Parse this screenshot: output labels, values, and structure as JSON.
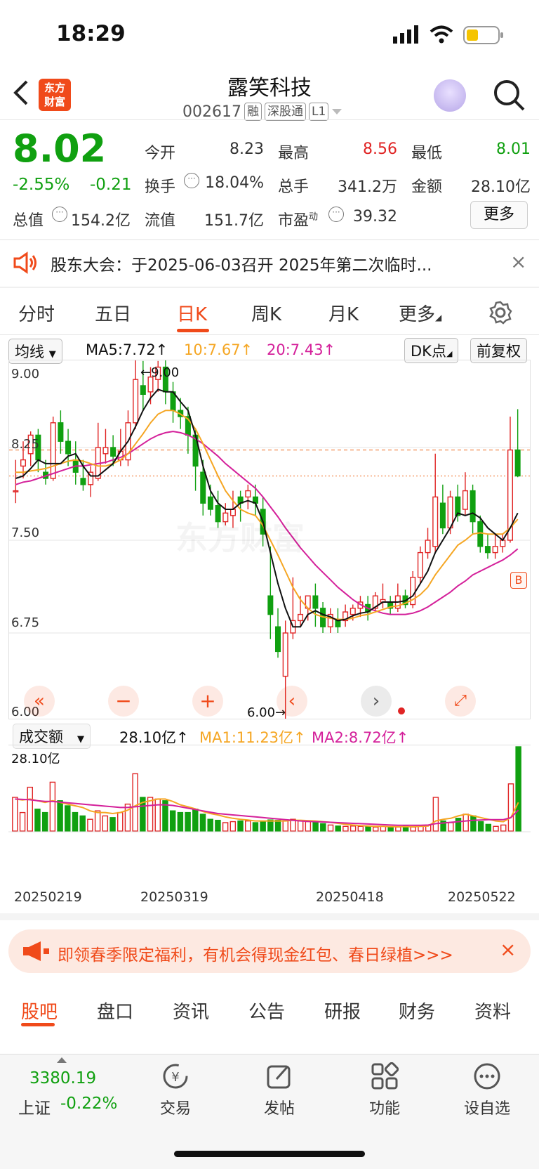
{
  "status": {
    "time": "18:29"
  },
  "header": {
    "logo": "东方财富",
    "name": "露笑科技",
    "code": "002617",
    "tags": [
      "融",
      "深股通",
      "L1"
    ],
    "back_icon": "chevron-left-icon",
    "search_icon": "search-icon"
  },
  "quote": {
    "price": "8.02",
    "pct": "-2.55%",
    "change": "-0.21",
    "rows": [
      [
        {
          "l": "今开",
          "v": "8.23",
          "c": "#333333"
        },
        {
          "l": "最高",
          "v": "8.56",
          "c": "#e02424"
        },
        {
          "l": "最低",
          "v": "8.01",
          "c": "#10a010"
        }
      ],
      [
        {
          "l": "换手",
          "v": "18.04%",
          "c": "#333333"
        },
        {
          "l": "总手",
          "v": "341.2万",
          "c": "#333333"
        },
        {
          "l": "金额",
          "v": "28.10亿",
          "c": "#333333"
        }
      ],
      [
        {
          "l": "总值",
          "v": "154.2亿",
          "c": "#333333"
        },
        {
          "l": "流值",
          "v": "151.7亿",
          "c": "#333333"
        },
        {
          "l": "市盈",
          "v": "39.32",
          "c": "#333333",
          "sup": "动"
        }
      ]
    ],
    "more": "更多"
  },
  "notice": {
    "text": "股东大会：于2025-06-03召开 2025年第二次临时...",
    "close": "×"
  },
  "ktabs": [
    "分时",
    "五日",
    "日K",
    "周K",
    "月K",
    "更多"
  ],
  "ma": {
    "select": "均线",
    "ma5": "MA5:7.72↑",
    "ma10": "10:7.67↑",
    "ma20": "20:7.43↑",
    "dk": "DK点",
    "fq": "前复权"
  },
  "kchart": {
    "yticks": [
      "9.00",
      "8.25",
      "7.50",
      "6.75",
      "6.00"
    ],
    "max_label": "←9.00",
    "min_label": "6.00→",
    "buy_marker": "B",
    "watermark": "东方财富"
  },
  "vol": {
    "select": "成交额",
    "value": "28.10亿↑",
    "ma1": "MA1:11.23亿↑",
    "ma2": "MA2:8.72亿↑",
    "top": "28.10亿",
    "dates": [
      "20250219",
      "20250319",
      "20250418",
      "20250522"
    ]
  },
  "promo": {
    "text": "即领春季限定福利，有机会得现金红包、春日绿植>>>",
    "close": "×"
  },
  "btabs": [
    "股吧",
    "盘口",
    "资讯",
    "公告",
    "研报",
    "财务",
    "资料"
  ],
  "nav": {
    "index_value": "3380.19",
    "index_name": "上证",
    "index_pct": "-0.22%",
    "items": [
      "交易",
      "发帖",
      "功能",
      "设自选"
    ]
  },
  "chart_data": {
    "type": "candlestick",
    "ylim": [
      6.0,
      9.0
    ],
    "ohlc": [
      [
        7.9,
        8.15,
        7.9,
        7.8
      ],
      [
        8.1,
        8.3,
        8.15,
        8.0
      ],
      [
        8.2,
        8.38,
        8.35,
        8.1
      ],
      [
        8.35,
        8.4,
        8.15,
        8.05
      ],
      [
        8.05,
        8.15,
        8.0,
        7.95
      ],
      [
        8.0,
        8.5,
        8.45,
        7.98
      ],
      [
        8.45,
        8.55,
        8.3,
        8.2
      ],
      [
        8.3,
        8.4,
        8.2,
        8.1
      ],
      [
        8.15,
        8.3,
        8.05,
        7.95
      ],
      [
        8.0,
        8.15,
        7.95,
        7.9
      ],
      [
        7.95,
        8.1,
        8.05,
        7.85
      ],
      [
        8.0,
        8.45,
        8.25,
        7.98
      ],
      [
        8.2,
        8.4,
        8.25,
        8.12
      ],
      [
        8.25,
        8.35,
        8.18,
        8.1
      ],
      [
        8.15,
        8.4,
        8.22,
        8.1
      ],
      [
        8.15,
        8.55,
        8.45,
        8.1
      ],
      [
        8.45,
        9.0,
        8.8,
        8.4
      ],
      [
        8.75,
        8.95,
        8.68,
        8.55
      ],
      [
        8.7,
        8.9,
        8.82,
        8.6
      ],
      [
        8.8,
        8.95,
        8.9,
        8.7
      ],
      [
        8.9,
        9.0,
        8.7,
        8.6
      ],
      [
        8.7,
        8.78,
        8.55,
        8.45
      ],
      [
        8.55,
        8.65,
        8.5,
        8.4
      ],
      [
        8.5,
        8.58,
        8.35,
        8.2
      ],
      [
        8.35,
        8.4,
        8.1,
        7.9
      ],
      [
        8.05,
        8.15,
        7.8,
        7.7
      ],
      [
        7.85,
        7.95,
        7.75,
        7.7
      ],
      [
        7.78,
        7.9,
        7.65,
        7.6
      ],
      [
        7.65,
        7.8,
        7.72,
        7.62
      ],
      [
        7.7,
        7.9,
        7.75,
        7.6
      ],
      [
        7.85,
        7.9,
        7.8,
        7.65
      ],
      [
        7.85,
        7.95,
        7.9,
        7.75
      ],
      [
        7.85,
        7.95,
        7.8,
        7.7
      ],
      [
        7.75,
        7.85,
        7.55,
        7.45
      ],
      [
        7.05,
        7.45,
        6.9,
        6.7
      ],
      [
        6.8,
        6.95,
        6.6,
        6.55
      ],
      [
        6.4,
        6.85,
        6.75,
        6.0
      ],
      [
        6.75,
        7.2,
        6.85,
        6.7
      ],
      [
        6.85,
        7.05,
        6.9,
        6.8
      ],
      [
        6.95,
        7.05,
        7.05,
        6.85
      ],
      [
        7.05,
        7.15,
        6.95,
        6.8
      ],
      [
        6.95,
        7.0,
        6.8,
        6.75
      ],
      [
        6.8,
        6.95,
        6.9,
        6.75
      ],
      [
        6.85,
        6.95,
        6.8,
        6.75
      ],
      [
        6.85,
        6.98,
        6.92,
        6.8
      ],
      [
        6.9,
        6.98,
        6.95,
        6.85
      ],
      [
        6.95,
        7.05,
        7.0,
        6.88
      ],
      [
        6.98,
        7.05,
        6.92,
        6.85
      ],
      [
        6.95,
        7.08,
        7.05,
        6.92
      ],
      [
        7.0,
        7.15,
        7.02,
        6.95
      ],
      [
        7.0,
        7.05,
        6.95,
        6.9
      ],
      [
        6.95,
        7.15,
        7.05,
        6.92
      ],
      [
        7.05,
        7.1,
        6.98,
        6.95
      ],
      [
        6.98,
        7.25,
        7.2,
        6.95
      ],
      [
        7.2,
        7.45,
        7.4,
        7.15
      ],
      [
        7.4,
        7.6,
        7.5,
        7.35
      ],
      [
        7.45,
        8.2,
        7.85,
        7.4
      ],
      [
        7.8,
        7.95,
        7.6,
        7.55
      ],
      [
        7.6,
        7.9,
        7.85,
        7.55
      ],
      [
        7.85,
        7.95,
        7.7,
        7.65
      ],
      [
        7.75,
        8.05,
        7.9,
        7.7
      ],
      [
        7.9,
        7.95,
        7.65,
        7.55
      ],
      [
        7.65,
        7.7,
        7.45,
        7.4
      ],
      [
        7.45,
        7.55,
        7.4,
        7.35
      ],
      [
        7.4,
        7.55,
        7.45,
        7.35
      ],
      [
        7.45,
        7.55,
        7.5,
        7.4
      ],
      [
        7.5,
        8.5,
        8.23,
        7.48
      ],
      [
        8.23,
        8.56,
        8.02,
        8.01
      ]
    ],
    "ma5": [
      8.0,
      8.02,
      8.08,
      8.15,
      8.12,
      8.12,
      8.12,
      8.18,
      8.2,
      8.1,
      8.02,
      8.02,
      8.07,
      8.12,
      8.22,
      8.3,
      8.42,
      8.55,
      8.65,
      8.72,
      8.7,
      8.7,
      8.62,
      8.55,
      8.35,
      8.1,
      7.9,
      7.8,
      7.75,
      7.75,
      7.8,
      7.82,
      7.8,
      7.65,
      7.4,
      7.15,
      6.95,
      6.8,
      6.8,
      6.9,
      6.93,
      6.9,
      6.88,
      6.85,
      6.86,
      6.89,
      6.91,
      6.92,
      6.96,
      7.0,
      7.0,
      7.0,
      7.01,
      7.05,
      7.15,
      7.25,
      7.4,
      7.5,
      7.6,
      7.72,
      7.7,
      7.72,
      7.68,
      7.6,
      7.55,
      7.5,
      7.6,
      7.72
    ],
    "ma10": [
      8.05,
      8.05,
      8.06,
      8.07,
      8.08,
      8.1,
      8.12,
      8.14,
      8.15,
      8.14,
      8.12,
      8.1,
      8.1,
      8.12,
      8.15,
      8.2,
      8.28,
      8.36,
      8.45,
      8.52,
      8.55,
      8.55,
      8.52,
      8.48,
      8.4,
      8.28,
      8.15,
      8.02,
      7.9,
      7.82,
      7.75,
      7.72,
      7.7,
      7.62,
      7.5,
      7.38,
      7.25,
      7.12,
      7.02,
      6.95,
      6.9,
      6.88,
      6.87,
      6.86,
      6.86,
      6.87,
      6.89,
      6.9,
      6.92,
      6.94,
      6.96,
      6.97,
      6.99,
      7.02,
      7.06,
      7.12,
      7.22,
      7.3,
      7.38,
      7.46,
      7.5,
      7.55,
      7.56,
      7.55,
      7.55,
      7.55,
      7.6,
      7.67
    ],
    "ma20": [
      7.95,
      7.97,
      7.98,
      8.0,
      8.02,
      8.04,
      8.06,
      8.08,
      8.1,
      8.1,
      8.11,
      8.12,
      8.13,
      8.15,
      8.17,
      8.2,
      8.24,
      8.28,
      8.32,
      8.35,
      8.37,
      8.38,
      8.37,
      8.35,
      8.32,
      8.28,
      8.23,
      8.18,
      8.12,
      8.07,
      8.02,
      7.97,
      7.92,
      7.85,
      7.77,
      7.69,
      7.6,
      7.52,
      7.44,
      7.37,
      7.3,
      7.24,
      7.18,
      7.12,
      7.07,
      7.02,
      6.98,
      6.95,
      6.93,
      6.91,
      6.9,
      6.9,
      6.9,
      6.91,
      6.93,
      6.96,
      7.0,
      7.04,
      7.08,
      7.13,
      7.17,
      7.22,
      7.25,
      7.28,
      7.31,
      7.34,
      7.38,
      7.43
    ],
    "volume": [
      1.0,
      0.55,
      1.3,
      0.65,
      0.55,
      1.45,
      0.9,
      0.75,
      0.55,
      0.45,
      0.35,
      0.6,
      0.45,
      0.4,
      0.55,
      0.8,
      1.7,
      1.0,
      1.0,
      0.95,
      0.9,
      0.6,
      0.55,
      0.55,
      0.65,
      0.5,
      0.35,
      0.32,
      0.25,
      0.28,
      0.3,
      0.3,
      0.25,
      0.28,
      0.33,
      0.32,
      0.3,
      0.35,
      0.3,
      0.28,
      0.26,
      0.22,
      0.18,
      0.15,
      0.14,
      0.15,
      0.14,
      0.14,
      0.12,
      0.14,
      0.12,
      0.12,
      0.14,
      0.12,
      0.16,
      0.18,
      1.0,
      0.3,
      0.25,
      0.38,
      0.5,
      0.45,
      0.28,
      0.2,
      0.14,
      0.18,
      1.4,
      2.5
    ],
    "vol_ma1": [
      0.95,
      0.92,
      0.95,
      0.9,
      0.85,
      0.9,
      0.85,
      0.8,
      0.75,
      0.7,
      0.6,
      0.55,
      0.55,
      0.52,
      0.55,
      0.62,
      0.75,
      0.85,
      0.9,
      0.95,
      0.95,
      0.88,
      0.78,
      0.72,
      0.66,
      0.58,
      0.52,
      0.48,
      0.42,
      0.38,
      0.35,
      0.33,
      0.3,
      0.3,
      0.3,
      0.3,
      0.3,
      0.32,
      0.32,
      0.31,
      0.3,
      0.28,
      0.26,
      0.23,
      0.2,
      0.18,
      0.16,
      0.15,
      0.14,
      0.14,
      0.13,
      0.13,
      0.13,
      0.13,
      0.14,
      0.15,
      0.3,
      0.35,
      0.38,
      0.45,
      0.5,
      0.45,
      0.4,
      0.35,
      0.3,
      0.28,
      0.4,
      0.85
    ],
    "vol_ma2": [
      0.95,
      0.94,
      0.93,
      0.9,
      0.88,
      0.88,
      0.86,
      0.84,
      0.82,
      0.8,
      0.78,
      0.76,
      0.74,
      0.72,
      0.7,
      0.7,
      0.72,
      0.74,
      0.76,
      0.78,
      0.78,
      0.76,
      0.72,
      0.68,
      0.64,
      0.6,
      0.56,
      0.52,
      0.5,
      0.48,
      0.46,
      0.44,
      0.42,
      0.4,
      0.38,
      0.36,
      0.34,
      0.32,
      0.3,
      0.29,
      0.28,
      0.27,
      0.26,
      0.25,
      0.24,
      0.23,
      0.22,
      0.21,
      0.2,
      0.19,
      0.18,
      0.17,
      0.17,
      0.17,
      0.17,
      0.18,
      0.22,
      0.24,
      0.26,
      0.28,
      0.3,
      0.32,
      0.33,
      0.34,
      0.34,
      0.34,
      0.4,
      0.62
    ]
  },
  "colors": {
    "up": "#e02424",
    "down": "#10a010",
    "ma5": "#111111",
    "ma10": "#f5a623",
    "ma20": "#d4209a",
    "accent": "#f04a1a"
  }
}
